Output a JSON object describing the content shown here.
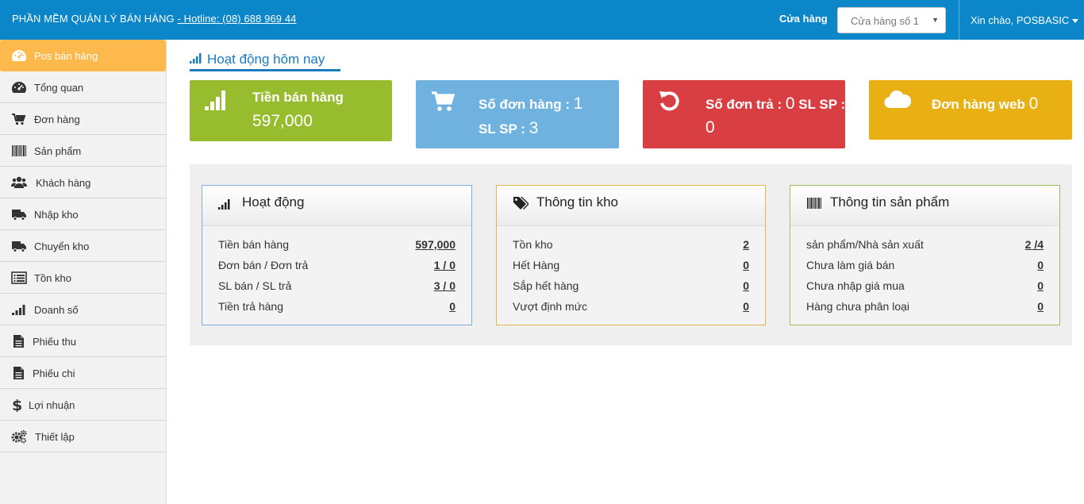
{
  "header": {
    "brand": "PHẦN MỀM QUẢN LÝ BÁN HÀNG",
    "hotline": "- Hotline: (08) 688 969 44",
    "store_label": "Cửa hàng",
    "store_selected": "Cửa hàng số 1",
    "greeting": "Xin chào, POSBASIC"
  },
  "sidebar": {
    "items": [
      {
        "label": "Pos bán hàng",
        "icon": "dashboard-icon"
      },
      {
        "label": "Tổng quan",
        "icon": "dashboard-icon"
      },
      {
        "label": "Đơn hàng",
        "icon": "cart-icon"
      },
      {
        "label": "Sản phẩm",
        "icon": "barcode-icon"
      },
      {
        "label": "Khách hàng",
        "icon": "users-icon"
      },
      {
        "label": "Nhập kho",
        "icon": "truck-icon"
      },
      {
        "label": "Chuyển kho",
        "icon": "truck-icon"
      },
      {
        "label": "Tồn kho",
        "icon": "list-icon"
      },
      {
        "label": "Doanh số",
        "icon": "signal-icon"
      },
      {
        "label": "Phiếu thu",
        "icon": "file-icon"
      },
      {
        "label": "Phiếu chi",
        "icon": "file-icon"
      },
      {
        "label": "Lợi nhuận",
        "icon": "dollar-icon"
      },
      {
        "label": "Thiết lập",
        "icon": "gears-icon"
      }
    ]
  },
  "main": {
    "title": "Hoạt động hôm nay",
    "tiles": {
      "sales": {
        "label": "Tiền bán hàng",
        "value": "597,000"
      },
      "orders": {
        "label": "Số đơn hàng :",
        "value": "1",
        "sub_label": "SL SP :",
        "sub_value": "3"
      },
      "returns": {
        "label": "Số đơn trả :",
        "value": "0",
        "sub_label": "SL SP :",
        "sub_value": "0"
      },
      "web": {
        "label": "Đơn hàng web",
        "value": "0"
      }
    },
    "panels": {
      "activity": {
        "title": "Hoạt động",
        "rows": [
          {
            "label": "Tiền bán hàng",
            "value": "597,000"
          },
          {
            "label": "Đơn bán / Đơn trả",
            "value": "1 / 0"
          },
          {
            "label": "SL bán / SL trả",
            "value": "3 / 0"
          },
          {
            "label": "Tiền trả hàng",
            "value": "0"
          }
        ]
      },
      "warehouse": {
        "title": "Thông tin kho",
        "rows": [
          {
            "label": "Tồn kho",
            "value": "2"
          },
          {
            "label": "Hết Hàng",
            "value": "0"
          },
          {
            "label": "Sắp hết hàng",
            "value": "0"
          },
          {
            "label": "Vượt định mức",
            "value": "0"
          }
        ]
      },
      "product": {
        "title": "Thông tin sản phẩm",
        "rows": [
          {
            "label": "sản phẩm/Nhà sản xuất",
            "value": "2 /4"
          },
          {
            "label": "Chưa làm giá bán",
            "value": "0"
          },
          {
            "label": "Chưa nhập giá mua",
            "value": "0"
          },
          {
            "label": "Hàng chưa phân loại",
            "value": "0"
          }
        ]
      }
    }
  },
  "colors": {
    "header": "#0a86c9",
    "active_nav": "#fdb94c",
    "tile_sales": "#97bd2e",
    "tile_orders": "#6fb2e0",
    "tile_returns": "#d93f42",
    "tile_web": "#e9b013"
  }
}
